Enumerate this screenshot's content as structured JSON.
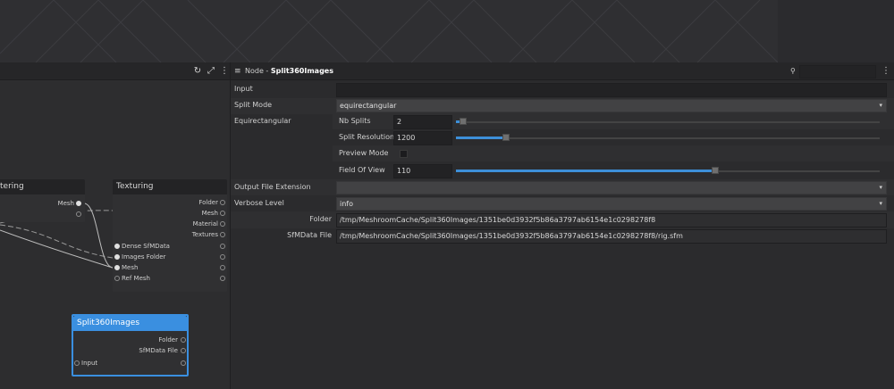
{
  "graph": {
    "nodes": {
      "meshfiltering": {
        "title": "tering",
        "outputs": [
          {
            "label": "Mesh"
          },
          {
            "label": ""
          }
        ]
      },
      "texturing": {
        "title": "Texturing",
        "outputs": [
          {
            "label": "Folder"
          },
          {
            "label": "Mesh"
          },
          {
            "label": "Material"
          },
          {
            "label": "Textures"
          }
        ],
        "inputs": [
          {
            "label": "Dense SfMData"
          },
          {
            "label": "Images Folder"
          },
          {
            "label": "Mesh"
          },
          {
            "label": "Ref Mesh"
          }
        ]
      },
      "split360": {
        "title": "Split360Images",
        "outputs": [
          {
            "label": "Folder"
          },
          {
            "label": "SfMData File"
          }
        ],
        "inputs": [
          {
            "label": "Input"
          }
        ]
      }
    }
  },
  "editor": {
    "title_prefix": "Node - ",
    "title_node": "Split360Images",
    "attributes": {
      "input_label": "Input",
      "input_value": "",
      "split_mode_label": "Split Mode",
      "split_mode_value": "equirectangular",
      "equirect_label": "Equirectangular",
      "nb_splits_label": "Nb Splits",
      "nb_splits_value": "2",
      "split_resolution_label": "Split Resolution",
      "split_resolution_value": "1200",
      "preview_mode_label": "Preview Mode",
      "fov_label": "Field Of View",
      "fov_value": "110",
      "output_ext_label": "Output File Extension",
      "output_ext_value": "",
      "verbose_label": "Verbose Level",
      "verbose_value": "info",
      "folder_label": "Folder",
      "folder_value": "/tmp/MeshroomCache/Split360Images/1351be0d3932f5b86a3797ab6154e1c0298278f8",
      "sfmdata_label": "SfMData File",
      "sfmdata_value": "/tmp/MeshroomCache/Split360Images/1351be0d3932f5b86a3797ab6154e1c0298278f8/rig.sfm"
    },
    "sliders": {
      "nb_splits": 0.02,
      "split_resolution": 0.12,
      "field_of_view": 0.61
    }
  },
  "colors": {
    "accent": "#3a8fe0"
  }
}
